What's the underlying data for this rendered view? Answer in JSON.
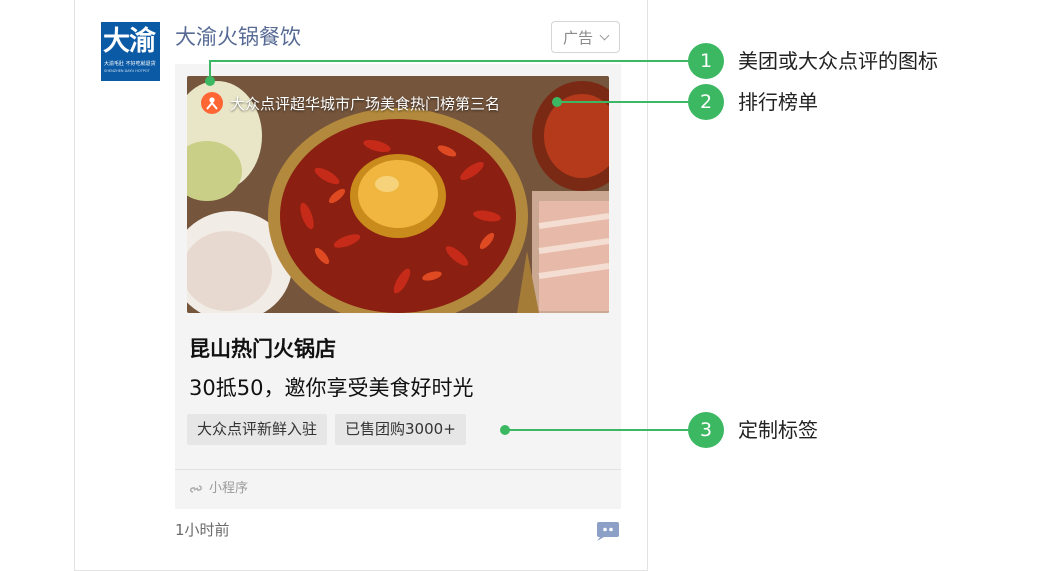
{
  "account": {
    "name": "大渝火锅餐饮",
    "avatar_text": "大渝",
    "avatar_sub": "大渝毛肚 不好吃就退货",
    "avatar_fine": "SHENZHEN DAYU HOTPOT"
  },
  "ad_button": {
    "label": "广告"
  },
  "ad": {
    "ranking_text": "大众点评超华城市广场美食热门榜第三名",
    "title": "昆山热门火锅店",
    "subtitle": "30抵50，邀你享受美食好时光",
    "tags": [
      "大众点评新鲜入驻",
      "已售团购3000+"
    ],
    "mini_program": "小程序"
  },
  "post_time": "1小时前",
  "callouts": [
    {
      "number": "1",
      "label": "美团或大众点评的图标"
    },
    {
      "number": "2",
      "label": "排行榜单"
    },
    {
      "number": "3",
      "label": "定制标签"
    }
  ],
  "colors": {
    "link_blue": "#576b95",
    "callout_green": "#3cb862",
    "dianping_orange": "#ff6633"
  }
}
